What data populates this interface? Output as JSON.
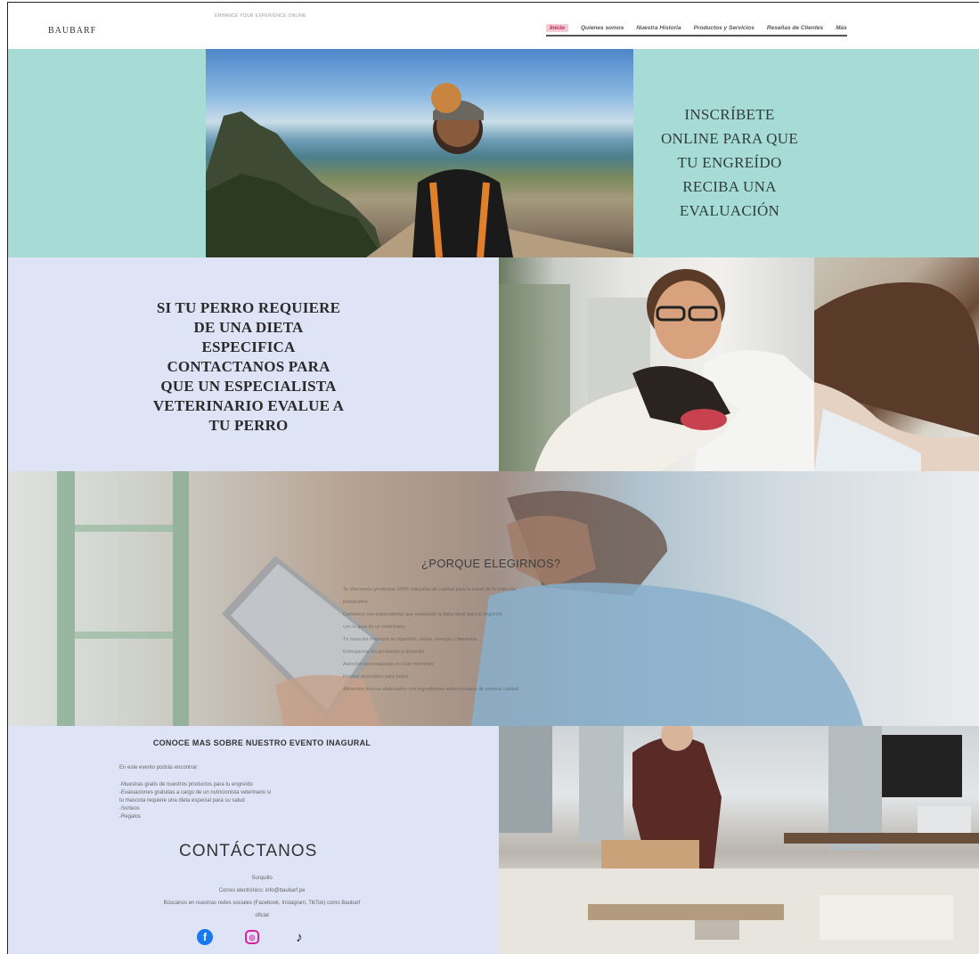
{
  "header": {
    "logo": "BAUBARF",
    "tagline": "ENHANCE YOUR EXPERIENCE ONLINE",
    "nav": [
      "Inicio",
      "Quienes somos",
      "Nuestra Historia",
      "Productos y Servicios",
      "Reseñas de Clientes",
      "Más"
    ]
  },
  "hero": {
    "lines": [
      "INSCRÍBETE",
      "ONLINE PARA QUE",
      "TU ENGREÍDO",
      "RECIBA UNA",
      "EVALUACIÓN"
    ]
  },
  "diet": {
    "lines": [
      "SI TU PERRO  REQUIERE",
      "DE UNA DIETA",
      "ESPECIFICA",
      "CONTACTANOS  PARA",
      "QUE UN ESPECIALISTA",
      "VETERINARIO EVALUE A",
      "TU PERRO"
    ]
  },
  "why": {
    "title": "¿PORQUE ELEGIRNOS?",
    "lines": [
      "Te ofrecemos productos 100% naturales de calidad para la salud de tu mascota",
      "preparados",
      "Contamos con especialistas que evaluarán la dieta ideal para tu engreído",
      "con la guía de un veterinario",
      "Tu mascota mejorará su digestión, pelaje, energía y bienestar",
      "Entregamos los productos a domicilio",
      "Atención personalizada en todo momento",
      "Precios accesibles para todos",
      "Alimentos frescos elaborados con ingredientes seleccionados de primera calidad"
    ]
  },
  "event": {
    "title": "CONOCE MAS SOBRE NUESTRO EVENTO INAGURAL",
    "intro": "En este evento podrás encontrar:",
    "items": [
      "-Muestras gratis de nuestros productos para tu engreído",
      "-Evaluaciones gratuitas a cargo de un nutricionista veterinario si",
      "tu mascota requiere una dieta especial para su salud",
      "-Sorteos",
      "-Regalos"
    ]
  },
  "contact": {
    "title": "CONTÁCTANOS",
    "lines": [
      "Surquillo",
      "Correo electrónico: info@baubarf.pe",
      "Búscanos en nuestras redes sociales (Facebook, Instagram, TikTok) como Baubarf",
      "oficial"
    ],
    "social": [
      {
        "name": "facebook-icon",
        "glyph": "f"
      },
      {
        "name": "instagram-icon",
        "glyph": "◎"
      },
      {
        "name": "tiktok-icon",
        "glyph": "♪"
      }
    ]
  },
  "colors": {
    "mint": "#a6dcd5",
    "lavender": "#dfe3f6",
    "nav_active_bg": "#f6c9d2"
  }
}
